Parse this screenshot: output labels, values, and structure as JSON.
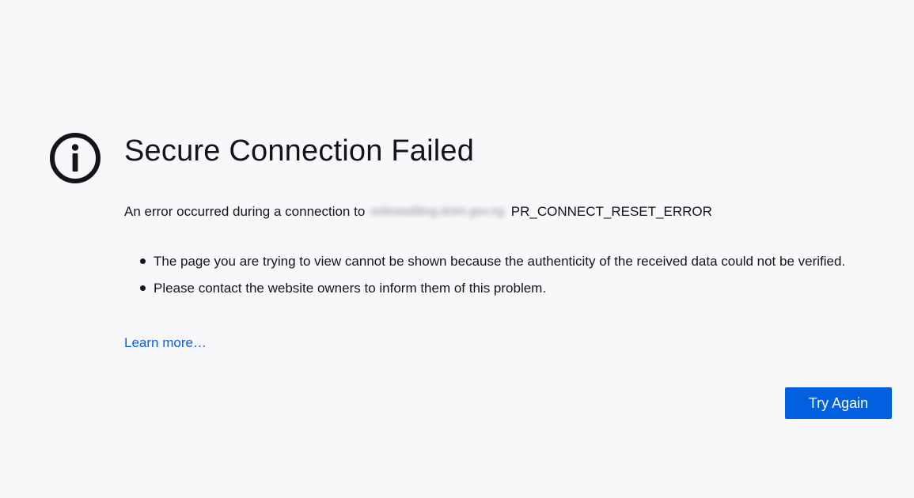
{
  "page": {
    "icon": "info-icon",
    "title": "Secure Connection Failed",
    "short_desc_prefix": "An error occurred during a connection to",
    "hostname_blurred": "onlineediting.dctm.gov.ng",
    "error_code": "PR_CONNECT_RESET_ERROR",
    "bullets": [
      "The page you are trying to view cannot be shown because the authenticity of the received data could not be verified.",
      "Please contact the website owners to inform them of this problem."
    ],
    "learn_more_label": "Learn more…",
    "try_again_label": "Try Again"
  },
  "colors": {
    "background": "#f8f8fa",
    "text": "#15141a",
    "link": "#0061e0",
    "button": "#0060df",
    "button_text": "#ffffff"
  }
}
